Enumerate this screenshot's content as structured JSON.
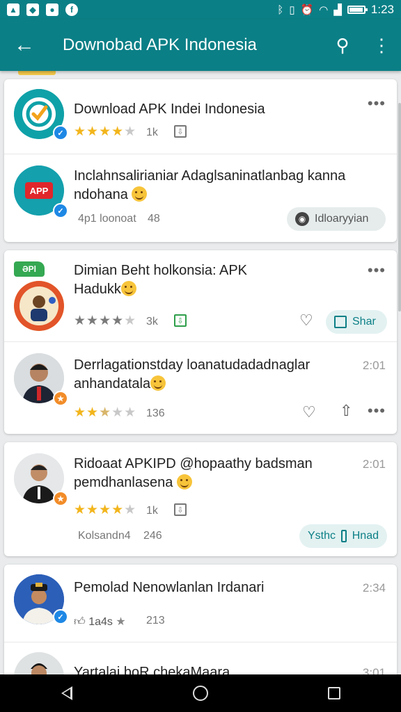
{
  "status_bar": {
    "time": "1:23",
    "battery_level": 0.85,
    "notification_icons": [
      "gallery-icon",
      "image-icon",
      "shop-icon",
      "shazam-icon"
    ],
    "system_icons": [
      "bluetooth-icon",
      "vibrate-icon",
      "alarm-icon",
      "wifi-icon",
      "signal-icon"
    ]
  },
  "app_bar": {
    "title": "Downobad APK Indonesia",
    "back_icon": "arrow-left-icon",
    "search_icon": "search-icon",
    "menu_icon": "more-vert-icon"
  },
  "colors": {
    "primary": "#0b7f86",
    "star": "#f2b51c",
    "green_tag": "#35a852"
  },
  "feed": [
    {
      "rows": [
        {
          "title": "Download APK Indei Indonesia",
          "rating": 4,
          "meta": "1k",
          "menu": "•••"
        },
        {
          "title_line1": "Inclahnsalirianiar Adaglsaninatlanbag kanna",
          "title_line2": "ndohana",
          "meta1": "4p1 loonoat",
          "meta2": "48",
          "pill": "Idloaryyian"
        }
      ]
    },
    {
      "rows": [
        {
          "tag": "ƏPl",
          "title_line1": "Dimian Beht holkonsia: APK",
          "title_line2": "Hadukk",
          "rating": 4,
          "meta": "3k",
          "pill": "Shar",
          "menu": "•••"
        },
        {
          "title_line1": "Derrlagationstday loanatudadadnaglar",
          "title_line2": "anhandatala",
          "time": "2:01",
          "rating": 2.5,
          "meta": "136",
          "menu": "•••"
        }
      ]
    },
    {
      "rows": [
        {
          "title_line1": "Ridoaat APKIPD @hopaathy badsman",
          "title_line2": "pemdhanlasena",
          "time": "2:01",
          "rating": 4,
          "meta": "1k",
          "meta1": "Kolsandn4",
          "meta2": "246",
          "pill_left": "Ysthc",
          "pill_right": "Hnad"
        }
      ]
    },
    {
      "rows": [
        {
          "title": "Pemolad Nenowlanlan Irdanari",
          "time": "2:34",
          "meta1": "1a4s",
          "meta2": "213"
        },
        {
          "title": "Yartalai boR chekaMaara",
          "time": "3:01"
        }
      ]
    }
  ]
}
